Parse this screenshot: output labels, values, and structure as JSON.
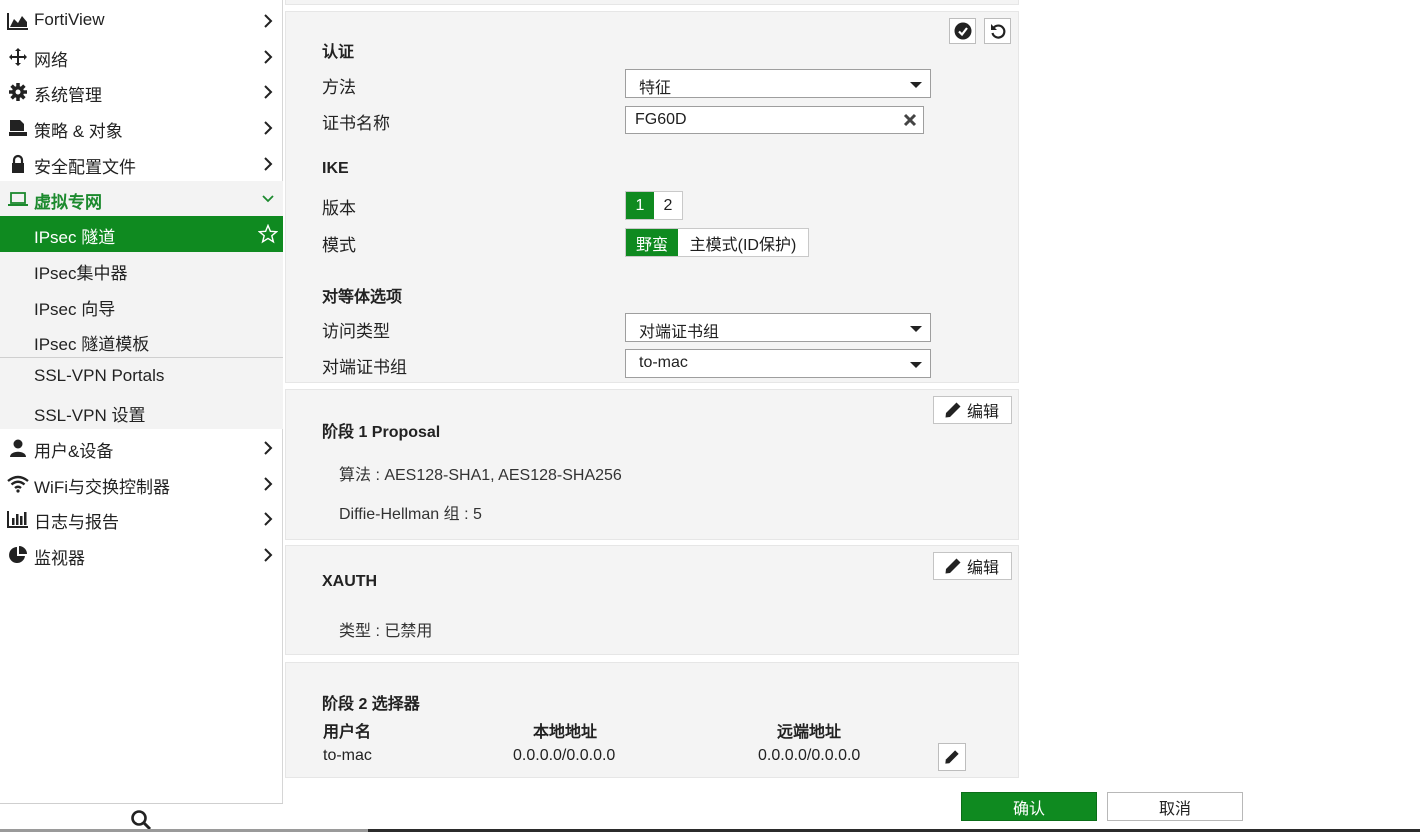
{
  "sidebar": {
    "items": [
      {
        "label": "FortiView",
        "icon": "chart-area-icon"
      },
      {
        "label": "网络",
        "icon": "move-arrows-icon"
      },
      {
        "label": "系统管理",
        "icon": "gear-icon"
      },
      {
        "label": "策略 & 对象",
        "icon": "clipboard-icon"
      },
      {
        "label": "安全配置文件",
        "icon": "lock-icon"
      },
      {
        "label": "虚拟专网",
        "icon": "laptop-icon"
      },
      {
        "label": "用户&设备",
        "icon": "user-icon"
      },
      {
        "label": "WiFi与交换控制器",
        "icon": "wifi-icon"
      },
      {
        "label": "日志与报告",
        "icon": "bar-chart-icon"
      },
      {
        "label": "监视器",
        "icon": "pie-chart-icon"
      }
    ],
    "vpn_subitems": [
      "IPsec 隧道",
      "IPsec集中器",
      "IPsec 向导",
      "IPsec 隧道模板",
      "SSL-VPN Portals",
      "SSL-VPN 设置"
    ],
    "accent": "#0f8a20"
  },
  "auth": {
    "heading": "认证",
    "method_label": "方法",
    "method_value": "特征",
    "cert_label": "证书名称",
    "cert_value": "FG60D"
  },
  "ike": {
    "heading": "IKE",
    "version_label": "版本",
    "version_options": [
      "1",
      "2"
    ],
    "mode_label": "模式",
    "mode_options": [
      "野蛮",
      "主模式(ID保护)"
    ]
  },
  "peer": {
    "heading": "对等体选项",
    "access_label": "访问类型",
    "access_value": "对端证书组",
    "group_label": "对端证书组",
    "group_value": "to-mac"
  },
  "phase1": {
    "heading": "阶段 1 Proposal",
    "edit_label": "编辑",
    "algo": "算法 : AES128-SHA1, AES128-SHA256",
    "dh": "Diffie-Hellman 组 : 5"
  },
  "xauth": {
    "heading": "XAUTH",
    "edit_label": "编辑",
    "type": "类型 : 已禁用"
  },
  "phase2": {
    "heading": "阶段 2 选择器",
    "columns": [
      "用户名",
      "本地地址",
      "远端地址"
    ],
    "rows": [
      [
        "to-mac",
        "0.0.0.0/0.0.0.0",
        "0.0.0.0/0.0.0.0"
      ]
    ]
  },
  "footer": {
    "ok_label": "确认",
    "cancel_label": "取消"
  }
}
